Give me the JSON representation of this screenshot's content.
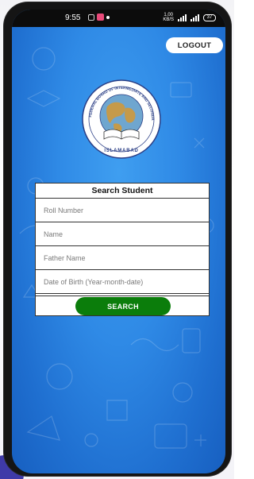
{
  "status_bar": {
    "time": "9:55",
    "net_speed_value": "1.00",
    "net_speed_unit": "KB/S",
    "battery_level": "37"
  },
  "header": {
    "logout_label": "LOGOUT"
  },
  "logo": {
    "text_arc": "FEDERAL BOARD OF INTERMEDIATE AND SECONDARY EDUCATION",
    "text_bottom": "ISLAMABAD"
  },
  "search_form": {
    "title": "Search Student",
    "fields": [
      {
        "placeholder": "Roll Number",
        "value": ""
      },
      {
        "placeholder": "Name",
        "value": ""
      },
      {
        "placeholder": "Father Name",
        "value": ""
      },
      {
        "placeholder": "Date of Birth (Year-month-date)",
        "value": ""
      }
    ],
    "submit_label": "SEARCH"
  },
  "colors": {
    "background_blue": "#2f8ae6",
    "search_button_green": "#0b7d0b",
    "status_bar": "#0c0c0c"
  }
}
